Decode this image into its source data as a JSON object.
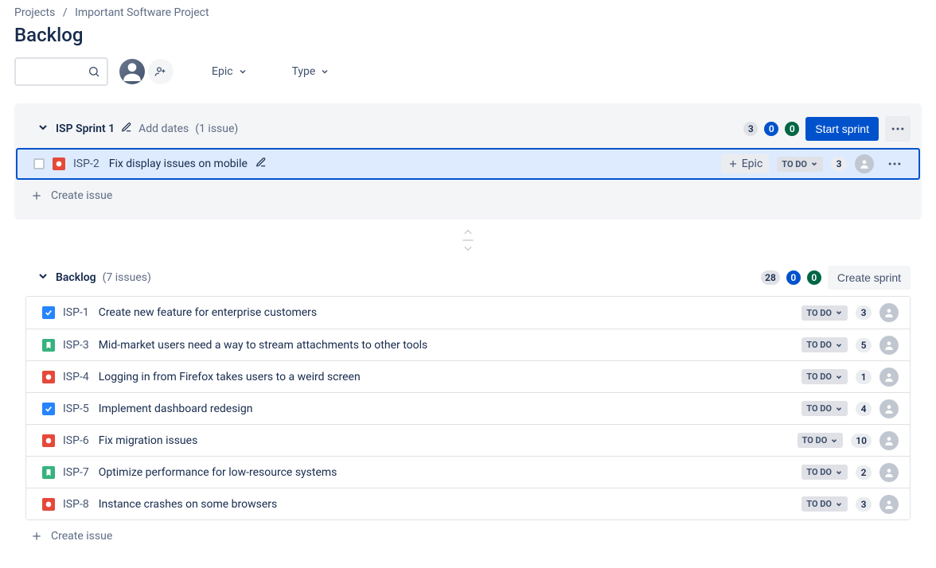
{
  "breadcrumb": {
    "root": "Projects",
    "project": "Important Software Project"
  },
  "page_title": "Backlog",
  "filters": {
    "epic": "Epic",
    "type": "Type"
  },
  "sprint": {
    "name": "ISP Sprint 1",
    "add_dates": "Add dates",
    "count_text": "(1 issue)",
    "counts": {
      "todo": "3",
      "inprogress": "0",
      "done": "0"
    },
    "start_button": "Start sprint",
    "epic_button": "Epic",
    "create_issue": "Create issue",
    "issues": [
      {
        "key": "ISP-2",
        "summary": "Fix display issues on mobile",
        "type": "bug",
        "status": "TO DO",
        "points": "3",
        "selected": true
      }
    ]
  },
  "backlog": {
    "title": "Backlog",
    "count_text": "(7 issues)",
    "counts": {
      "todo": "28",
      "inprogress": "0",
      "done": "0"
    },
    "create_sprint": "Create sprint",
    "create_issue": "Create issue",
    "issues": [
      {
        "key": "ISP-1",
        "summary": "Create new feature for enterprise customers",
        "type": "task",
        "status": "TO DO",
        "points": "3"
      },
      {
        "key": "ISP-3",
        "summary": "Mid-market users need a way to stream attachments to other tools",
        "type": "story",
        "status": "TO DO",
        "points": "5"
      },
      {
        "key": "ISP-4",
        "summary": "Logging in from Firefox takes users to a weird screen",
        "type": "bug",
        "status": "TO DO",
        "points": "1"
      },
      {
        "key": "ISP-5",
        "summary": "Implement dashboard redesign",
        "type": "task",
        "status": "TO DO",
        "points": "4"
      },
      {
        "key": "ISP-6",
        "summary": "Fix migration issues",
        "type": "bug",
        "status": "TO DO",
        "points": "10"
      },
      {
        "key": "ISP-7",
        "summary": "Optimize performance for low-resource systems",
        "type": "story",
        "status": "TO DO",
        "points": "2"
      },
      {
        "key": "ISP-8",
        "summary": "Instance crashes on some browsers",
        "type": "bug",
        "status": "TO DO",
        "points": "3"
      }
    ]
  }
}
